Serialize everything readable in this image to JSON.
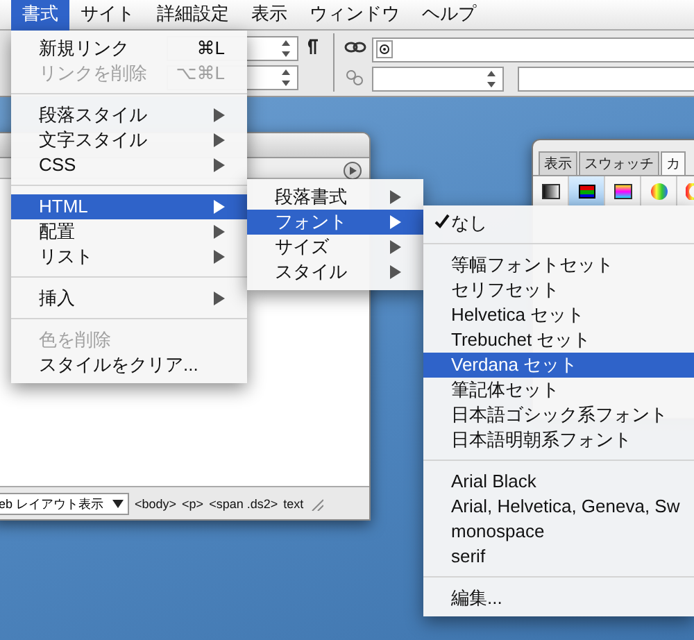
{
  "menu_bar": [
    {
      "label": "書式",
      "selected": true
    },
    {
      "label": "サイト",
      "selected": false
    },
    {
      "label": "詳細設定",
      "selected": false
    },
    {
      "label": "表示",
      "selected": false
    },
    {
      "label": "ウィンドウ",
      "selected": false
    },
    {
      "label": "ヘルプ",
      "selected": false
    }
  ],
  "document_window": {
    "view_mode": "eb レイアウト表示",
    "tag_path": [
      "<body>",
      "<p>",
      "<span .ds2>",
      "text"
    ]
  },
  "palette": {
    "tabs": [
      {
        "label": "表示",
        "selected": false
      },
      {
        "label": "スウォッチ",
        "selected": false
      },
      {
        "label": "カ",
        "selected": true
      }
    ]
  },
  "format_menu": [
    {
      "kind": "item",
      "label": "新規リンク",
      "shortcut": "⌘L",
      "disabled": false,
      "submenu": false,
      "selected": false
    },
    {
      "kind": "item",
      "label": "リンクを削除",
      "shortcut": "⌥⌘L",
      "disabled": true,
      "submenu": false,
      "selected": false
    },
    {
      "kind": "separator"
    },
    {
      "kind": "item",
      "label": "段落スタイル",
      "disabled": false,
      "submenu": true,
      "selected": false
    },
    {
      "kind": "item",
      "label": "文字スタイル",
      "disabled": false,
      "submenu": true,
      "selected": false
    },
    {
      "kind": "item",
      "label": "CSS",
      "disabled": false,
      "submenu": true,
      "selected": false
    },
    {
      "kind": "separator"
    },
    {
      "kind": "item",
      "label": "HTML",
      "disabled": false,
      "submenu": true,
      "selected": true
    },
    {
      "kind": "item",
      "label": "配置",
      "disabled": false,
      "submenu": true,
      "selected": false
    },
    {
      "kind": "item",
      "label": "リスト",
      "disabled": false,
      "submenu": true,
      "selected": false
    },
    {
      "kind": "separator"
    },
    {
      "kind": "item",
      "label": "挿入",
      "disabled": false,
      "submenu": true,
      "selected": false
    },
    {
      "kind": "separator"
    },
    {
      "kind": "item",
      "label": "色を削除",
      "disabled": true,
      "submenu": false,
      "selected": false
    },
    {
      "kind": "item",
      "label": "スタイルをクリア...",
      "disabled": false,
      "submenu": false,
      "selected": false
    }
  ],
  "html_submenu": [
    {
      "kind": "item",
      "label": "段落書式",
      "submenu": true,
      "selected": false
    },
    {
      "kind": "item",
      "label": "フォント",
      "submenu": true,
      "selected": true
    },
    {
      "kind": "item",
      "label": "サイズ",
      "submenu": true,
      "selected": false
    },
    {
      "kind": "item",
      "label": "スタイル",
      "submenu": true,
      "selected": false
    }
  ],
  "font_submenu": [
    {
      "kind": "item",
      "label": "なし",
      "checked": true,
      "selected": false
    },
    {
      "kind": "separator"
    },
    {
      "kind": "item",
      "label": "等幅フォントセット",
      "checked": false,
      "selected": false
    },
    {
      "kind": "item",
      "label": "セリフセット",
      "checked": false,
      "selected": false
    },
    {
      "kind": "item",
      "label": "Helvetica セット",
      "checked": false,
      "selected": false
    },
    {
      "kind": "item",
      "label": "Trebuchet セット",
      "checked": false,
      "selected": false
    },
    {
      "kind": "item",
      "label": "Verdana セット",
      "checked": false,
      "selected": true
    },
    {
      "kind": "item",
      "label": "筆記体セット",
      "checked": false,
      "selected": false
    },
    {
      "kind": "item",
      "label": "日本語ゴシック系フォント",
      "checked": false,
      "selected": false
    },
    {
      "kind": "item",
      "label": "日本語明朝系フォント",
      "checked": false,
      "selected": false
    },
    {
      "kind": "separator"
    },
    {
      "kind": "item",
      "label": "Arial Black",
      "checked": false,
      "selected": false
    },
    {
      "kind": "item",
      "label": "Arial, Helvetica, Geneva, Sw",
      "checked": false,
      "selected": false
    },
    {
      "kind": "item",
      "label": "monospace",
      "checked": false,
      "selected": false
    },
    {
      "kind": "item",
      "label": "serif",
      "checked": false,
      "selected": false
    },
    {
      "kind": "separator"
    },
    {
      "kind": "item",
      "label": "編集...",
      "checked": false,
      "selected": false
    }
  ]
}
